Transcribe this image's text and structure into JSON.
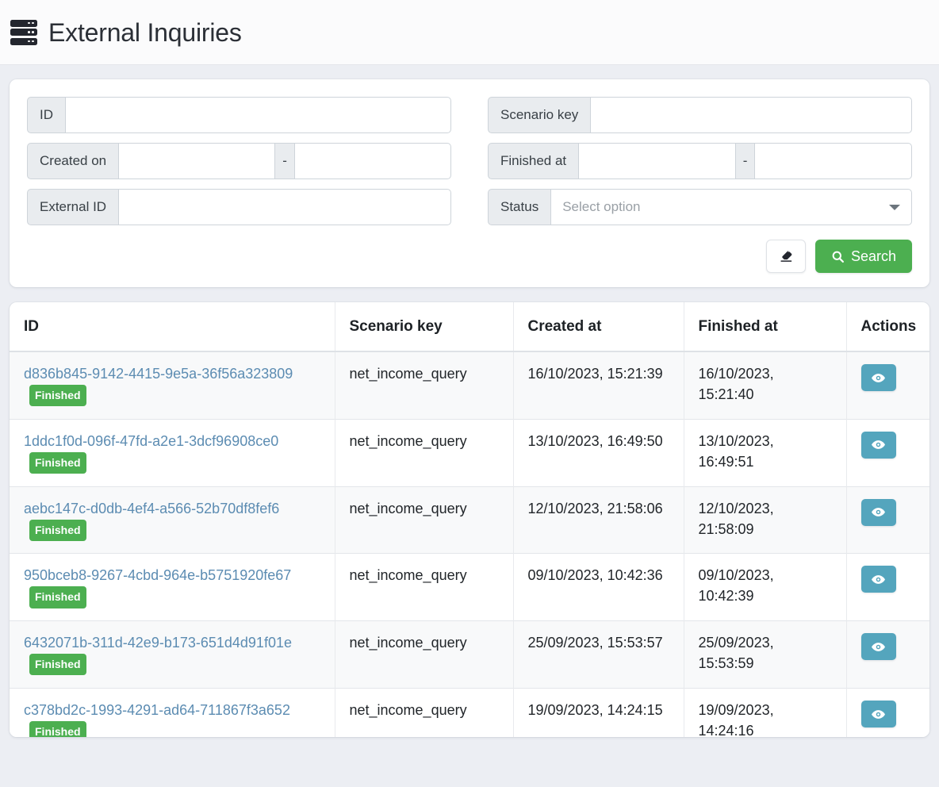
{
  "header": {
    "title": "External Inquiries",
    "icon": "server-icon"
  },
  "filters": {
    "id": {
      "label": "ID",
      "value": "",
      "placeholder": ""
    },
    "scenario_key": {
      "label": "Scenario key",
      "value": "",
      "placeholder": ""
    },
    "created_on": {
      "label": "Created on",
      "separator": "-",
      "from_value": "",
      "to_value": "",
      "from_placeholder": "",
      "to_placeholder": ""
    },
    "finished_at": {
      "label": "Finished at",
      "separator": "-",
      "from_value": "",
      "to_value": "",
      "from_placeholder": "",
      "to_placeholder": ""
    },
    "external_id": {
      "label": "External ID",
      "value": "",
      "placeholder": ""
    },
    "status": {
      "label": "Status",
      "placeholder": "Select option",
      "value": "",
      "caret_icon": "chevron-down-icon"
    },
    "clear_button": {
      "label": "",
      "icon": "eraser-icon"
    },
    "search_button": {
      "label": "Search",
      "icon": "search-icon"
    }
  },
  "table": {
    "columns": [
      "ID",
      "Scenario key",
      "Created at",
      "Finished at",
      "Actions"
    ],
    "row_action_icon": "eye-icon",
    "rows": [
      {
        "id": "d836b845-9142-4415-9e5a-36f56a323809",
        "status": "Finished",
        "scenario_key": "net_income_query",
        "created_at": "16/10/2023, 15:21:39",
        "finished_at": "16/10/2023, 15:21:40"
      },
      {
        "id": "1ddc1f0d-096f-47fd-a2e1-3dcf96908ce0",
        "status": "Finished",
        "scenario_key": "net_income_query",
        "created_at": "13/10/2023, 16:49:50",
        "finished_at": "13/10/2023, 16:49:51"
      },
      {
        "id": "aebc147c-d0db-4ef4-a566-52b70df8fef6",
        "status": "Finished",
        "scenario_key": "net_income_query",
        "created_at": "12/10/2023, 21:58:06",
        "finished_at": "12/10/2023, 21:58:09"
      },
      {
        "id": "950bceb8-9267-4cbd-964e-b5751920fe67",
        "status": "Finished",
        "scenario_key": "net_income_query",
        "created_at": "09/10/2023, 10:42:36",
        "finished_at": "09/10/2023, 10:42:39"
      },
      {
        "id": "6432071b-311d-42e9-b173-651d4d91f01e",
        "status": "Finished",
        "scenario_key": "net_income_query",
        "created_at": "25/09/2023, 15:53:57",
        "finished_at": "25/09/2023, 15:53:59"
      },
      {
        "id": "c378bd2c-1993-4291-ad64-711867f3a652",
        "status": "Finished",
        "scenario_key": "net_income_query",
        "created_at": "19/09/2023, 14:24:15",
        "finished_at": "19/09/2023, 14:24:16"
      }
    ]
  },
  "colors": {
    "page_background": "#eceef3",
    "accent_green": "#4caf50",
    "badge_green": "#4caf50",
    "view_button_teal": "#54a5bd",
    "link_blue": "#5c8cb2",
    "header_background": "#fbfbfc"
  }
}
